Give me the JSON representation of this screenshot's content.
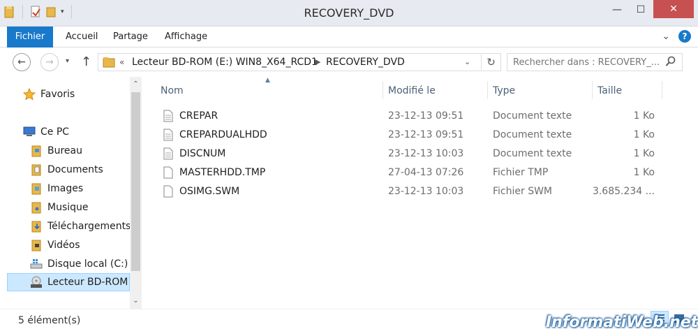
{
  "window": {
    "title": "RECOVERY_DVD",
    "minimize": "—",
    "maximize": "☐",
    "close": "✕"
  },
  "ribbon": {
    "tabs": [
      "Fichier",
      "Accueil",
      "Partage",
      "Affichage"
    ],
    "help": "?"
  },
  "address": {
    "prefix": "«",
    "crumbs": [
      "Lecteur BD-ROM (E:) WIN8_X64_RCD1",
      "RECOVERY_DVD"
    ]
  },
  "search": {
    "placeholder": "Rechercher dans : RECOVERY_..."
  },
  "nav": {
    "favorites": "Favoris",
    "this_pc": "Ce PC",
    "items": [
      "Bureau",
      "Documents",
      "Images",
      "Musique",
      "Téléchargements",
      "Vidéos",
      "Disque local (C:)",
      "Lecteur BD-ROM"
    ]
  },
  "columns": [
    "Nom",
    "Modifié le",
    "Type",
    "Taille"
  ],
  "files": [
    {
      "name": "CREPAR",
      "date": "23-12-13 09:51",
      "type": "Document texte",
      "size": "1 Ko",
      "icon": "text-file-icon"
    },
    {
      "name": "CREPARDUALHDD",
      "date": "23-12-13 09:51",
      "type": "Document texte",
      "size": "1 Ko",
      "icon": "text-file-icon"
    },
    {
      "name": "DISCNUM",
      "date": "23-12-13 10:03",
      "type": "Document texte",
      "size": "1 Ko",
      "icon": "text-file-icon"
    },
    {
      "name": "MASTERHDD.TMP",
      "date": "27-04-13 07:26",
      "type": "Fichier TMP",
      "size": "1 Ko",
      "icon": "blank-file-icon"
    },
    {
      "name": "OSIMG.SWM",
      "date": "23-12-13 10:03",
      "type": "Fichier SWM",
      "size": "3.685.234 ...",
      "icon": "blank-file-icon"
    }
  ],
  "status": {
    "count": "5 élément(s)"
  },
  "watermark": "InformatiWeb.net",
  "colors": {
    "accent": "#1979ca",
    "selection": "#cce8ff",
    "close": "#c75050"
  }
}
